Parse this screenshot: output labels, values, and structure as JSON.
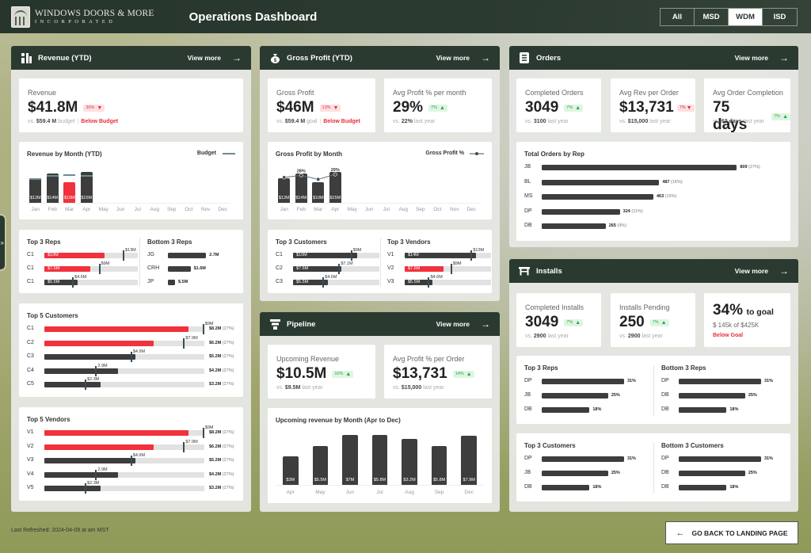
{
  "header": {
    "brand_line1": "WINDOWS DOORS & MORE",
    "brand_line2": "INCORPORATED",
    "title": "Operations Dashboard",
    "filters": [
      {
        "label": "All",
        "active": false
      },
      {
        "label": "MSD",
        "active": false
      },
      {
        "label": "WDM",
        "active": true
      },
      {
        "label": "ISD",
        "active": false
      }
    ]
  },
  "sidebar_toggle": "»",
  "revenue": {
    "title": "Revenue (YTD)",
    "view_more": "View more",
    "icon": "bar-chart-icon",
    "kpi": {
      "label": "Revenue",
      "value": "$41.8M",
      "badge": "30%",
      "trend": "down",
      "sub_prefix": "vs.",
      "sub_value": "$59.4 M",
      "sub_suffix": "budget",
      "status": "Below Budget"
    },
    "by_month": {
      "title": "Revenue by Month (YTD)",
      "legend": "Budget",
      "months": [
        "Jan",
        "Feb",
        "Mar",
        "Apr",
        "May",
        "Jun",
        "Jul",
        "Aug",
        "Sep",
        "Oct",
        "Nov",
        "Dec"
      ],
      "values": [
        12,
        14,
        10,
        15
      ],
      "labels": [
        "$12M",
        "$14M",
        "$10M",
        "$15M"
      ],
      "budget": [
        11,
        12.7,
        13,
        12.5
      ],
      "below_budget": [
        false,
        false,
        true,
        false
      ]
    },
    "top_reps": {
      "title": "Top 3 Reps",
      "rows": [
        {
          "name": "C1",
          "value": 10,
          "label": "$10M",
          "target": 13,
          "target_label": "$13M",
          "below": true
        },
        {
          "name": "C1",
          "value": 7.6,
          "label": "$7.6M",
          "target": 9,
          "target_label": "$9M",
          "below": true
        },
        {
          "name": "C1",
          "value": 5.5,
          "label": "$5.5M",
          "target": 4.6,
          "target_label": "$4.6M",
          "below": false
        }
      ]
    },
    "bottom_reps": {
      "title": "Bottom 3 Reps",
      "rows": [
        {
          "name": "JG",
          "value": 2.7,
          "label": "2.7M"
        },
        {
          "name": "CRH",
          "value": 1.6,
          "label": "$1.6M"
        },
        {
          "name": "JP",
          "value": 0.5,
          "label": "$.5M"
        }
      ]
    },
    "top_customers": {
      "title": "Top 5 Customers",
      "rows": [
        {
          "name": "C1",
          "value": 8.2,
          "target": 9,
          "target_label": "$9M",
          "end": "$8.2M",
          "pct": "(27%)",
          "below": true
        },
        {
          "name": "C2",
          "value": 6.2,
          "target": 7.9,
          "target_label": "$7.9M",
          "end": "$6.2M",
          "pct": "(27%)",
          "below": true
        },
        {
          "name": "C3",
          "value": 5.2,
          "target": 4.9,
          "target_label": "$4.9M",
          "end": "$5.2M",
          "pct": "(27%)",
          "below": false
        },
        {
          "name": "C4",
          "value": 4.2,
          "target": 2.9,
          "target_label": "2.9M",
          "end": "$4.2M",
          "pct": "(27%)",
          "below": false
        },
        {
          "name": "C5",
          "value": 3.2,
          "target": 2.3,
          "target_label": "$2.3M",
          "end": "$3.2M",
          "pct": "(27%)",
          "below": false
        }
      ]
    },
    "top_vendors": {
      "title": "Top 5 Vendors",
      "rows": [
        {
          "name": "V1",
          "value": 8.2,
          "target": 9,
          "target_label": "$9M",
          "end": "$8.2M",
          "pct": "(27%)",
          "below": true
        },
        {
          "name": "V2",
          "value": 6.2,
          "target": 7.9,
          "target_label": "$7.9M",
          "end": "$6.2M",
          "pct": "(27%)",
          "below": true
        },
        {
          "name": "V3",
          "value": 5.2,
          "target": 4.9,
          "target_label": "$4.9M",
          "end": "$5.2M",
          "pct": "(27%)",
          "below": false
        },
        {
          "name": "V4",
          "value": 4.2,
          "target": 2.9,
          "target_label": "2.9M",
          "end": "$4.2M",
          "pct": "(27%)",
          "below": false
        },
        {
          "name": "V5",
          "value": 3.2,
          "target": 2.3,
          "target_label": "$2.3M",
          "end": "$3.2M",
          "pct": "(27%)",
          "below": false
        }
      ]
    }
  },
  "gross_profit": {
    "title": "Gross Profit (YTD)",
    "view_more": "View more",
    "kpi1": {
      "label": "Gross Profit",
      "value": "$46M",
      "badge": "13%",
      "trend": "down",
      "sub_prefix": "vs.",
      "sub_value": "$59.4 M",
      "sub_suffix": "goal",
      "status": "Below Budget"
    },
    "kpi2": {
      "label": "Avg Profit % per month",
      "value": "29%",
      "badge": "7%",
      "trend": "up",
      "sub_prefix": "vs.",
      "sub_value": "22%",
      "sub_suffix": "last year"
    },
    "by_month": {
      "title": "Gross Profit by Month",
      "legend": "Gross Profit %",
      "months": [
        "Jan",
        "Feb",
        "Mar",
        "Apr",
        "May",
        "Jun",
        "Jul",
        "Aug",
        "Sep",
        "Oct",
        "Nov",
        "Dec"
      ],
      "values": [
        12,
        14,
        10,
        15
      ],
      "labels": [
        "$12M",
        "$14M",
        "$10M",
        "$15M"
      ],
      "pct": [
        26,
        28,
        24,
        29
      ],
      "pct_labels": [
        "",
        "28%",
        "",
        "29%"
      ]
    },
    "top_customers": {
      "title": "Top 3 Customers",
      "rows": [
        {
          "name": "C1",
          "value": 10,
          "label": "$10M",
          "target": 9,
          "target_label": "$9M",
          "below": false
        },
        {
          "name": "C2",
          "value": 7.6,
          "label": "$7.6M",
          "target": 7.1,
          "target_label": "$7.1M",
          "below": false
        },
        {
          "name": "C3",
          "value": 5.5,
          "label": "$5.5M",
          "target": 4.6,
          "target_label": "$4.6M",
          "below": false
        }
      ]
    },
    "top_vendors": {
      "title": "Top 3 Vendors",
      "rows": [
        {
          "name": "V1",
          "value": 14,
          "label": "$14M",
          "target": 13,
          "target_label": "$13M",
          "below": false
        },
        {
          "name": "V2",
          "value": 7.6,
          "label": "$7.6M",
          "target": 9,
          "target_label": "$9M",
          "below": true
        },
        {
          "name": "V3",
          "value": 5.5,
          "label": "$5.5M",
          "target": 4.6,
          "target_label": "$4.6M",
          "below": false
        }
      ]
    }
  },
  "pipeline": {
    "title": "Pipeline",
    "view_more": "View more",
    "kpi1": {
      "label": "Upcoming Revenue",
      "value": "$10.5M",
      "badge": "10%",
      "trend": "up",
      "sub_prefix": "vs.",
      "sub_value": "$9.5M",
      "sub_suffix": "last year"
    },
    "kpi2": {
      "label": "Avg Profit % per Order",
      "value": "$13,731",
      "badge": "14%",
      "trend": "up",
      "sub_prefix": "vs.",
      "sub_value": "$15,000",
      "sub_suffix": "last year"
    },
    "by_month": {
      "title": "Upcoming revenue by Month (Apr to Dec)",
      "months": [
        "Apr",
        "May",
        "Jun",
        "Jul",
        "Aug",
        "Sep",
        "Dec"
      ],
      "labels": [
        "$3M",
        "$5.5M",
        "$7M",
        "$5.8M",
        "$3.2M",
        "$5.8M",
        "$7.9M"
      ],
      "values": [
        4.5,
        6.2,
        7.9,
        7.9,
        7.3,
        6.1,
        7.8
      ]
    }
  },
  "orders": {
    "title": "Orders",
    "view_more": "View more",
    "kpi1": {
      "label": "Completed Orders",
      "value": "3049",
      "badge": "7%",
      "trend": "up",
      "sub_prefix": "vs.",
      "sub_value": "3100",
      "sub_suffix": "last year"
    },
    "kpi2": {
      "label": "Avg Rev per Order",
      "value": "$13,731",
      "badge": "7%",
      "trend": "down",
      "sub_prefix": "vs.",
      "sub_value": "$15,000",
      "sub_suffix": "last year"
    },
    "kpi3": {
      "label": "Avg Order Completion",
      "value": "75 days",
      "badge": "7%",
      "trend": "up",
      "sub_prefix": "vs.",
      "sub_value": "63 days",
      "sub_suffix": "last year"
    },
    "by_rep": {
      "title": "Total Orders by Rep",
      "rows": [
        {
          "name": "JB",
          "value": 809,
          "label": "809",
          "pct": "(27%)"
        },
        {
          "name": "BL",
          "value": 487,
          "label": "487",
          "pct": "(16%)"
        },
        {
          "name": "MS",
          "value": 463,
          "label": "463",
          "pct": "(15%)"
        },
        {
          "name": "DP",
          "value": 324,
          "label": "324",
          "pct": "(11%)"
        },
        {
          "name": "DB",
          "value": 265,
          "label": "265",
          "pct": "(9%)"
        }
      ]
    }
  },
  "installs": {
    "title": "Installs",
    "view_more": "View more",
    "kpi1": {
      "label": "Completed Installs",
      "value": "3049",
      "badge": "7%",
      "trend": "up",
      "sub_prefix": "vs.",
      "sub_value": "2900",
      "sub_suffix": "last year"
    },
    "kpi2": {
      "label": "Installs Pending",
      "value": "250",
      "badge": "7%",
      "trend": "up",
      "sub_prefix": "vs.",
      "sub_value": "2900",
      "sub_suffix": "last year"
    },
    "goal": {
      "value": "34%",
      "suffix": "to goal",
      "detail": "$ 145k of $425K",
      "status": "Below Goal",
      "progress": 0.34
    },
    "top_reps": {
      "title": "Top 3 Reps",
      "rows": [
        {
          "name": "DP",
          "value": 31,
          "label": "31%"
        },
        {
          "name": "JB",
          "value": 25,
          "label": "25%"
        },
        {
          "name": "DB",
          "value": 18,
          "label": "18%"
        }
      ]
    },
    "bottom_reps": {
      "title": "Bottom 3 Reps",
      "rows": [
        {
          "name": "DP",
          "value": 31,
          "label": "31%"
        },
        {
          "name": "DB",
          "value": 25,
          "label": "25%"
        },
        {
          "name": "DB",
          "value": 18,
          "label": "18%"
        }
      ]
    },
    "top_customers": {
      "title": "Top 3 Customers",
      "rows": [
        {
          "name": "DP",
          "value": 31,
          "label": "31%"
        },
        {
          "name": "JB",
          "value": 25,
          "label": "25%"
        },
        {
          "name": "DB",
          "value": 18,
          "label": "18%"
        }
      ]
    },
    "bottom_customers": {
      "title": "Bottom 3 Customers",
      "rows": [
        {
          "name": "DP",
          "value": 31,
          "label": "31%"
        },
        {
          "name": "DB",
          "value": 25,
          "label": "25%"
        },
        {
          "name": "DB",
          "value": 18,
          "label": "18%"
        }
      ]
    }
  },
  "footer": {
    "last_refreshed": "Last Refreshed: 2024-04-09 at am MST",
    "back_button": "GO BACK TO LANDING PAGE"
  },
  "colors": {
    "header": "#2b3a30",
    "bar": "#3d3d3d",
    "below": "#f1313c",
    "up": "#2aa846",
    "down": "#e3303d"
  }
}
